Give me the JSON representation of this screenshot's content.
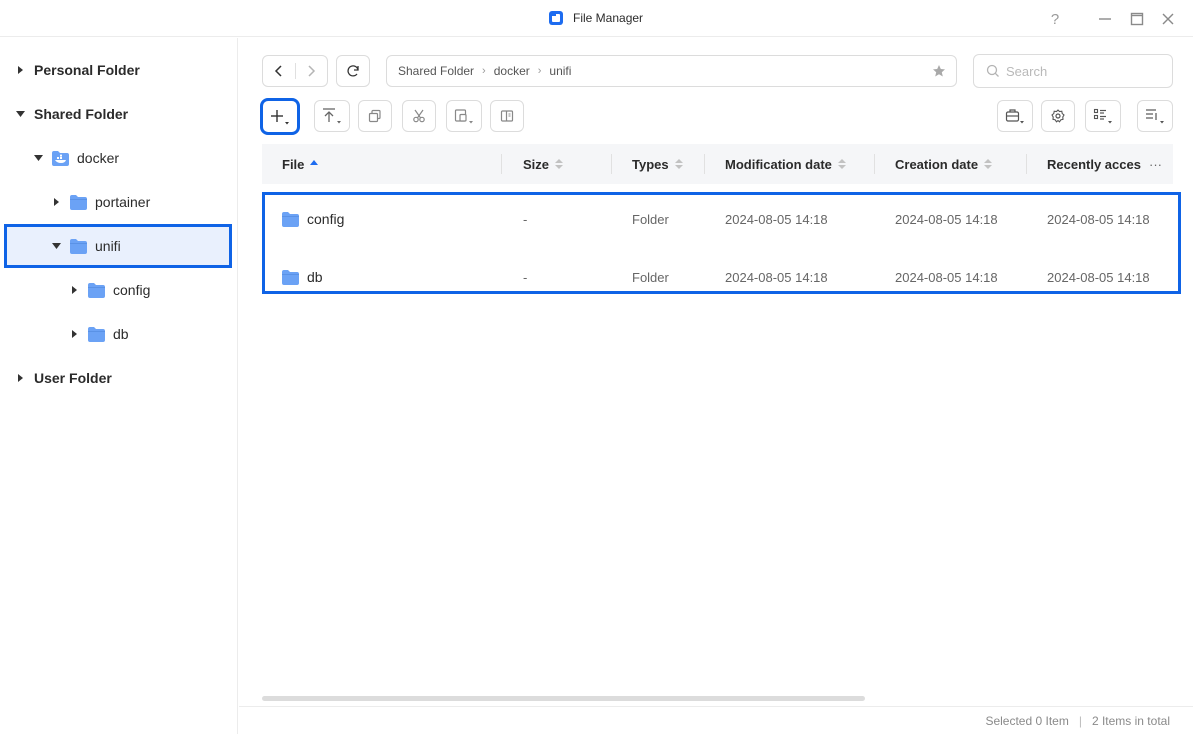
{
  "window": {
    "title": "File Manager",
    "help_icon": "question-icon",
    "minimize_icon": "minimize-icon",
    "maximize_icon": "maximize-icon",
    "close_icon": "close-icon"
  },
  "sidebar": {
    "items": [
      {
        "label": "Personal Folder",
        "expanded": false
      },
      {
        "label": "Shared Folder",
        "expanded": true
      },
      {
        "label": "docker",
        "expanded": true,
        "icon": "docker-folder-icon"
      },
      {
        "label": "portainer",
        "expanded": false
      },
      {
        "label": "unifi",
        "expanded": true,
        "selected": true
      },
      {
        "label": "config",
        "expanded": false
      },
      {
        "label": "db",
        "expanded": false
      },
      {
        "label": "User Folder",
        "expanded": false
      }
    ]
  },
  "breadcrumb": [
    "Shared Folder",
    "docker",
    "unifi"
  ],
  "search": {
    "placeholder": "Search"
  },
  "toolbar": {
    "buttons": [
      "add-icon",
      "upload-icon",
      "copy-icon",
      "cut-icon",
      "paste-icon",
      "compress-icon"
    ],
    "right_buttons": [
      "briefcase-icon",
      "settings-icon",
      "list-view-icon",
      "sort-icon"
    ]
  },
  "table": {
    "columns": [
      "File",
      "Size",
      "Types",
      "Modification date",
      "Creation date",
      "Recently acces"
    ],
    "more_label": "···",
    "rows": [
      {
        "name": "config",
        "size": "-",
        "type": "Folder",
        "modified": "2024-08-05 14:18",
        "created": "2024-08-05 14:18",
        "accessed": "2024-08-05 14:18"
      },
      {
        "name": "db",
        "size": "-",
        "type": "Folder",
        "modified": "2024-08-05 14:18",
        "created": "2024-08-05 14:18",
        "accessed": "2024-08-05 14:18"
      }
    ]
  },
  "status": {
    "selected": "Selected 0 Item",
    "separator": "|",
    "total": "2 Items in total"
  },
  "colors": {
    "accent": "#0f63e6",
    "folder": "#6ba2f5",
    "selected_bg": "#e9f0fd"
  }
}
